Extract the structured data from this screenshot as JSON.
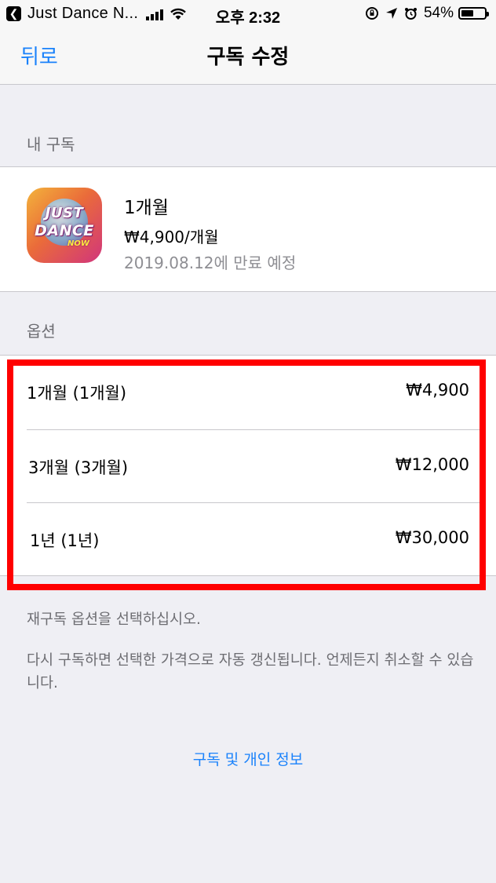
{
  "status_bar": {
    "back_app": "Just Dance N...",
    "time": "오후 2:32",
    "battery_percent": "54%",
    "battery_level": 0.54,
    "icons": [
      "back-arrow-icon",
      "signal-icon",
      "wifi-icon",
      "orientation-lock-icon",
      "location-icon",
      "alarm-icon",
      "battery-icon"
    ]
  },
  "nav": {
    "back_label": "뒤로",
    "title": "구독 수정"
  },
  "my_subscription": {
    "header": "내 구독",
    "app_icon_text": [
      "JUST",
      "DANCE",
      "NOW"
    ],
    "plan": "1개월",
    "price": "₩4,900/개월",
    "expiry": "2019.08.12에 만료 예정"
  },
  "options": {
    "header": "옵션",
    "items": [
      {
        "label": "1개월 (1개월)",
        "price": "₩4,900"
      },
      {
        "label": "3개월 (3개월)",
        "price": "₩12,000"
      },
      {
        "label": "1년 (1년)",
        "price": "₩30,000"
      }
    ]
  },
  "footer": {
    "line1": "재구독 옵션을 선택하십시오.",
    "line2": "다시 구독하면 선택한 가격으로 자동 갱신됩니다. 언제든지 취소할 수 있습니다.",
    "link": "구독 및 개인 정보"
  },
  "colors": {
    "accent": "#1a82fb",
    "highlight": "#ff0000",
    "background": "#efeff4"
  }
}
